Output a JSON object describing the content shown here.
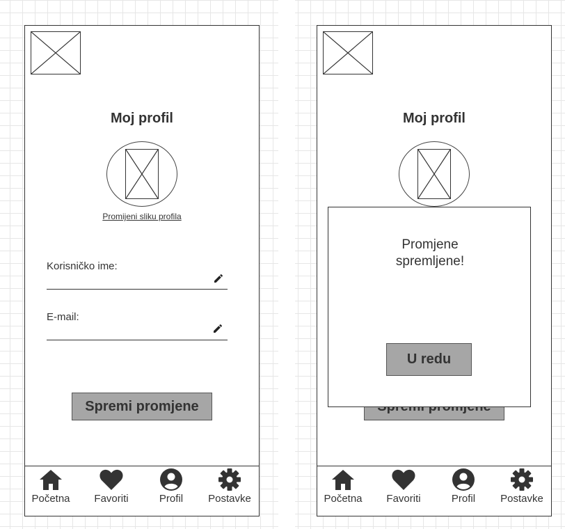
{
  "screens": [
    {
      "title": "Moj profil",
      "change_photo_link": "Promijeni sliku profila",
      "fields": {
        "username_label": "Korisničko ime:",
        "email_label": "E-mail:"
      },
      "save_button": "Spremi promjene",
      "nav": [
        "Početna",
        "Favoriti",
        "Profil",
        "Postavke"
      ]
    },
    {
      "title": "Moj profil",
      "save_button": "Spremi promjene",
      "dialog": {
        "message_line1": "Promjene",
        "message_line2": "spremljene!",
        "ok_button": "U redu"
      },
      "nav": [
        "Početna",
        "Favoriti",
        "Profil",
        "Postavke"
      ]
    }
  ],
  "icons": {
    "nav": [
      "home-icon",
      "heart-icon",
      "user-circle-icon",
      "gear-icon"
    ],
    "edit": "pencil-icon",
    "image_placeholder": "image-placeholder-icon"
  },
  "colors": {
    "button_fill": "#a6a6a6",
    "ink": "#333333",
    "grid": "#e6e6e6"
  }
}
